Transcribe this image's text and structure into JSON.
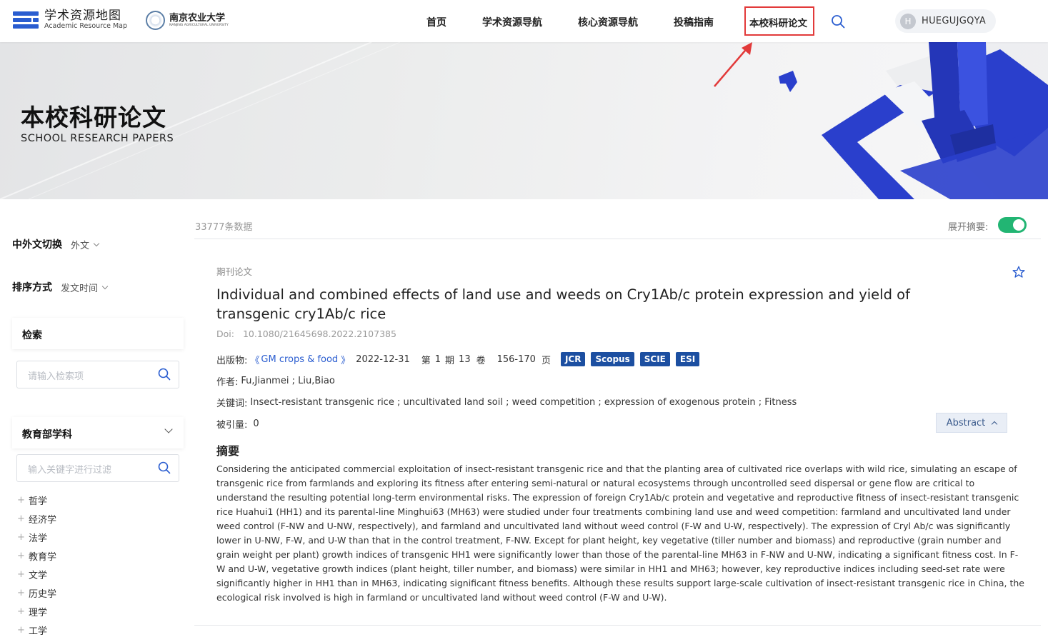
{
  "header": {
    "logo_cn": "学术资源地图",
    "logo_en": "Academic Resource Map",
    "university_cn": "南京农业大学",
    "university_en": "NANJING AGRICULTURAL UNIVERSITY",
    "nav": [
      "首页",
      "学术资源导航",
      "核心资源导航",
      "投稿指南",
      "本校科研论文"
    ],
    "active_nav": "本校科研论文",
    "user_initial": "H",
    "user_name": "HUEGUJGQYA"
  },
  "banner": {
    "title": "本校科研论文",
    "subtitle": "SCHOOL RESEARCH PAPERS"
  },
  "sidebar": {
    "lang_label": "中外文切换",
    "lang_value": "外文",
    "sort_label": "排序方式",
    "sort_value": "发文时间",
    "search_title": "检索",
    "search_placeholder": "请输入检索项",
    "discipline_title": "教育部学科",
    "filter_placeholder": "输入关键字进行过滤",
    "disciplines": [
      "哲学",
      "经济学",
      "法学",
      "教育学",
      "文学",
      "历史学",
      "理学",
      "工学"
    ]
  },
  "results": {
    "count": "33777条数据",
    "toggle_label": "展开摘要:",
    "toggle_on": true
  },
  "paper": {
    "type": "期刊论文",
    "title": "Individual and combined effects of land use and weeds on Cry1Ab/c protein expression and yield of transgenic cry1Ab/c rice",
    "doi_label": "Doi:",
    "doi": "10.1080/21645698.2022.2107385",
    "pub_label": "出版物:",
    "journal_open": "《",
    "journal": "GM crops & food",
    "journal_close": "》",
    "date": "2022-12-31",
    "issue_prefix": "第",
    "issue": "1",
    "issue_mid": "期",
    "volume": "13",
    "volume_suffix": "卷",
    "pages": "156-170",
    "pages_suffix": "页",
    "tags": [
      "JCR",
      "Scopus",
      "SCIE",
      "ESI"
    ],
    "author_label": "作者:",
    "authors": "Fu,Jianmei ; Liu,Biao",
    "keyword_label": "关键词:",
    "keywords": "Insect-resistant transgenic rice ; uncultivated land soil ; weed competition ; expression of exogenous protein ; Fitness",
    "cited_label": "被引量:",
    "cited": "0",
    "abstract_button": "Abstract",
    "abstract_heading": "摘要",
    "abstract": "Considering the anticipated commercial exploitation of insect-resistant transgenic rice and that the planting area of cultivated rice overlaps with wild rice, simulating an escape of transgenic rice from farmlands and exploring its fitness after entering semi-natural or natural ecosystems through uncontrolled seed dispersal or gene flow are critical to understand the resulting potential long-term environmental risks. The expression of foreign Cry1Ab/c protein and vegetative and reproductive fitness of insect-resistant transgenic rice Huahui1 (HH1) and its parental-line Minghui63 (MH63) were studied under four treatments combining land use and weed competition: farmland and uncultivated land under weed control (F-NW and U-NW, respectively), and farmland and uncultivated land without weed control (F-W and U-W, respectively). The expression of Cryl Ab/c was significantly lower in U-NW, F-W, and U-W than that in the control treatment, F-NW. Except for plant height, key vegetative (tiller number and biomass) and reproductive (grain number and grain weight per plant) growth indices of transgenic HH1 were significantly lower than those of the parental-line MH63 in F-NW and U-NW, indicating a significant fitness cost. In F-W and U-W, vegetative growth indices (plant height, tiller number, and biomass) were similar in HH1 and MH63; however, key reproductive indices including seed-set rate were significantly higher in HH1 than in MH63, indicating significant fitness benefits. Although these results support large-scale cultivation of insect-resistant transgenic rice in China, the ecological risk involved is high in farmland or uncultivated land without weed control (F-W and U-W)."
  },
  "colors": {
    "brand_blue": "#2a5dd0",
    "tag_blue": "#1c4fa1",
    "toggle_green": "#22b573",
    "highlight_red": "#e23a3a"
  }
}
